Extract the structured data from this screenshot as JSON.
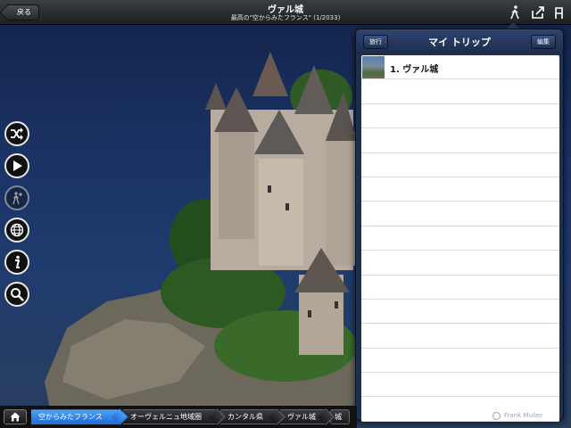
{
  "header": {
    "back_label": "戻る",
    "title": "ヴァル城",
    "subtitle": "最高の\"空からみたフランス\" (1/2033)"
  },
  "top_icons": [
    "walker-icon",
    "share-icon",
    "font-icon"
  ],
  "side_buttons": [
    "shuffle-icon",
    "play-icon",
    "add-trip-icon",
    "globe-icon",
    "info-icon",
    "search-icon"
  ],
  "popover": {
    "left_button": "旅行",
    "title": "マイ トリップ",
    "right_button": "編集",
    "items": [
      {
        "label": "1. ヴァル城"
      }
    ]
  },
  "breadcrumb": {
    "home_icon": "home-icon",
    "items": [
      "空からみたフランス",
      "オーヴェルニュ地域圏",
      "カンタル県",
      "ヴァル城",
      "城"
    ],
    "active_index": 0
  },
  "credit": "Frank Muller",
  "colors": {
    "accent": "#2f80ee",
    "sky": "#1b3366",
    "popover": "#1f2f4e"
  }
}
